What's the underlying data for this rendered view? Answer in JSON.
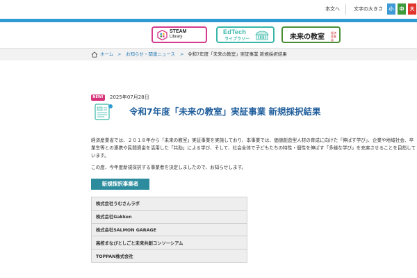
{
  "utility_bar": {
    "skip_to_content": "本文へ",
    "text_size_label": "文字の大きさ",
    "sizes": [
      "小",
      "中",
      "大"
    ],
    "colors": {
      "small": "#3e9ad6",
      "medium": "#3f9a3c",
      "large": "#e0342d"
    }
  },
  "header": {
    "logos": {
      "steam": {
        "line1": "STEAM",
        "line2": "Library",
        "color": "#d43b8c"
      },
      "edtech": {
        "line1": "EdTech",
        "line2": "ライブラリー",
        "color": "#38b7a8"
      },
      "mirai": {
        "title": "未来の教室",
        "sub": "経済産業省",
        "color": "#4a8f36"
      }
    },
    "accent_color": "#2f9bd3"
  },
  "breadcrumb": {
    "home": "ホーム",
    "separator": ">",
    "category": "お知らせ・関連ニュース",
    "current": "令和7年度「未来の教室」実証事業 新規採択結果"
  },
  "article": {
    "badge": "NEW!",
    "date": "2025年07月28日",
    "title": "令和7年度「未来の教室」実証事業 新規採択結果",
    "paragraph1": "経済産業省では、２０１８年から「未来の教室」実証事業を実施しており、本事業では、価値創造型人材の育成に向けた「伸ばす学び」、企業や地域社会、卒業生等との連携や民間資金を活用した「共助」による学び、そして、社会全体で子どもたちの特性・個性を伸ばす「多様な学び」を充実させることを目指しています。",
    "paragraph2": "この度、今年度新規採択する事業者を決定しましたので、お知らせします。",
    "section_heading": "新規採択事業者",
    "vendors": [
      "株式会社うむさんラボ",
      "株式会社Gakken",
      "株式会社SALMON GARAGE",
      "高校まなびとしごと未来共創コンソーシアム",
      "TOPPAN株式会社"
    ],
    "colors": {
      "title": "#1f5e9c",
      "badge": "#d6337a",
      "heading_bg": "#2c8c9e"
    }
  }
}
